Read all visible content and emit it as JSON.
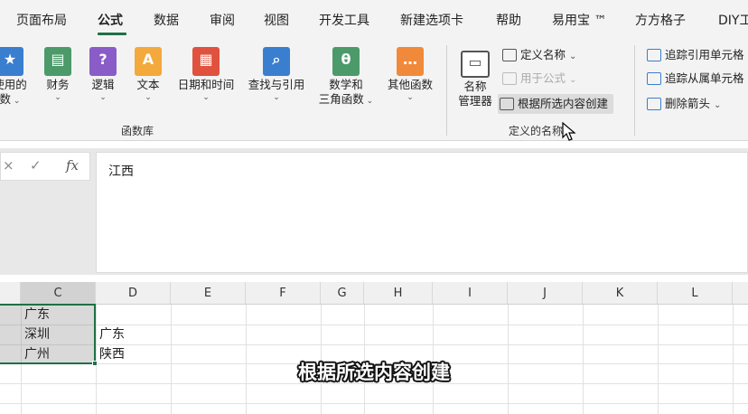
{
  "tabs": [
    {
      "label": "页面布局",
      "active": false
    },
    {
      "label": "公式",
      "active": true
    },
    {
      "label": "数据",
      "active": false
    },
    {
      "label": "审阅",
      "active": false
    },
    {
      "label": "视图",
      "active": false
    },
    {
      "label": "开发工具",
      "active": false
    },
    {
      "label": "新建选项卡",
      "active": false
    },
    {
      "label": "帮助",
      "active": false
    },
    {
      "label": "易用宝 ™",
      "active": false
    },
    {
      "label": "方方格子",
      "active": false
    },
    {
      "label": "DIY工",
      "active": false
    }
  ],
  "ribbon": {
    "function_library": {
      "label": "函数库",
      "buttons": [
        {
          "line1": "使用的",
          "line2": "数"
        },
        {
          "line1": "财务",
          "line2": ""
        },
        {
          "line1": "逻辑",
          "line2": ""
        },
        {
          "line1": "文本",
          "line2": ""
        },
        {
          "line1": "日期和时间",
          "line2": ""
        },
        {
          "line1": "查找与引用",
          "line2": ""
        },
        {
          "line1": "数学和",
          "line2": "三角函数"
        },
        {
          "line1": "其他函数",
          "line2": ""
        }
      ]
    },
    "defined_names": {
      "label": "定义的名称",
      "name_manager_line1": "名称",
      "name_manager_line2": "管理器",
      "define_name": "定义名称",
      "use_in_formula": "用于公式",
      "create_from_selection": "根据所选内容创建"
    },
    "formula_auditing": {
      "trace_precedents": "追踪引用单元格",
      "trace_dependents": "追踪从属单元格",
      "remove_arrows": "删除箭头"
    }
  },
  "formula_bar": {
    "cancel_glyph": "×",
    "enter_glyph": "✓",
    "fx_label": "fx",
    "content": "江西"
  },
  "grid": {
    "columns": [
      "C",
      "D",
      "E",
      "F",
      "G",
      "H",
      "I",
      "J",
      "K",
      "L"
    ],
    "cells": {
      "C1": "广东",
      "C2": "深圳",
      "C3": "广州",
      "D2": "广东",
      "D3": "陕西"
    }
  },
  "subtitle": "根据所选内容创建",
  "colors": {
    "accent": "#1e7145",
    "ribbon_bg": "#f3f3f3"
  },
  "icons": {
    "recent": "star-icon",
    "financial": "money-icon",
    "logical": "question-icon",
    "text": "text-A-icon",
    "date_time": "calendar-icon",
    "lookup": "search-book-icon",
    "math": "theta-icon",
    "more": "dots-book-icon",
    "name_manager": "name-tag-icon",
    "cursor": "mouse-pointer-icon"
  }
}
